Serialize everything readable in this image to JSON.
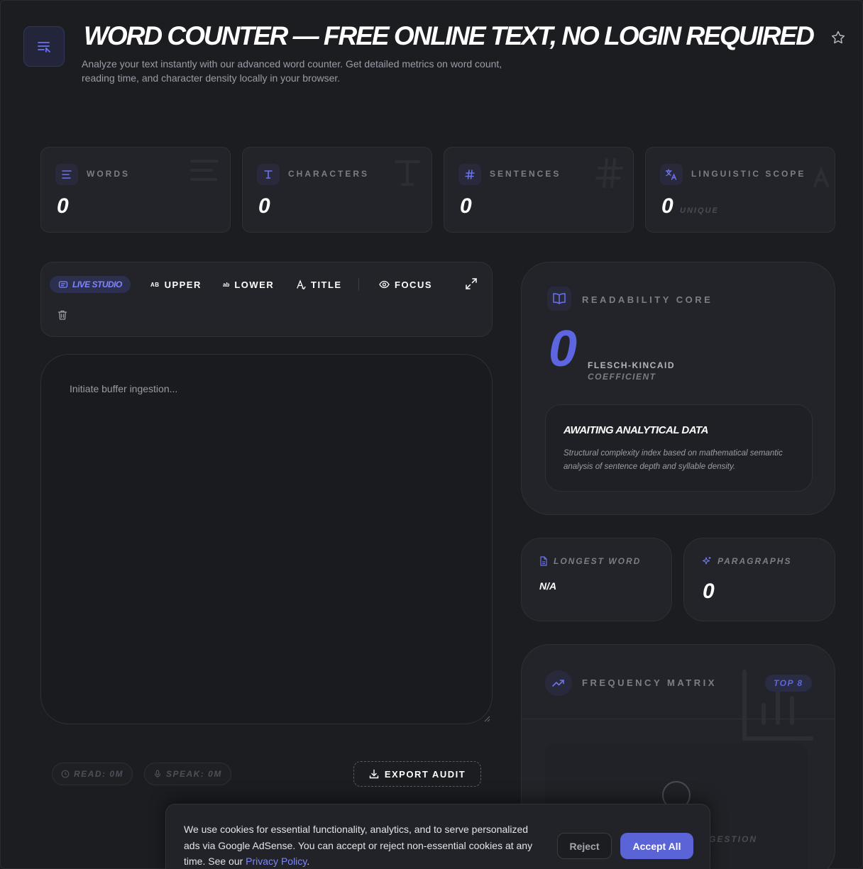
{
  "header": {
    "title": "WORD COUNTER — FREE ONLINE TEXT, NO LOGIN REQUIRED",
    "subtitle": "Analyze your text instantly with our advanced word counter. Get detailed metrics on word count, reading time, and character density locally in your browser.",
    "logo_icon": "text-lines-icon",
    "favorite_icon": "star-icon"
  },
  "stats": [
    {
      "label": "WORDS",
      "value": "0",
      "icon": "align-left-icon"
    },
    {
      "label": "CHARACTERS",
      "value": "0",
      "icon": "type-icon"
    },
    {
      "label": "SENTENCES",
      "value": "0",
      "icon": "hash-icon"
    },
    {
      "label": "LINGUISTIC SCOPE",
      "value": "0",
      "suffix": "UNIQUE",
      "icon": "translate-icon"
    }
  ],
  "toolbar": {
    "live_studio": "LIVE STUDIO",
    "upper": "UPPER",
    "upper_glyph": "AB",
    "lower": "LOWER",
    "lower_glyph": "ab",
    "title": "TITLE",
    "focus": "FOCUS"
  },
  "editor": {
    "placeholder": "Initiate buffer ingestion...",
    "value": ""
  },
  "footer": {
    "read": "READ: 0M",
    "speak": "SPEAK: 0M",
    "export": "EXPORT AUDIT"
  },
  "readability": {
    "label": "READABILITY CORE",
    "score": "0",
    "metric_line1": "FLESCH-KINCAID",
    "metric_line2": "COEFFICIENT",
    "status_title": "AWAITING ANALYTICAL DATA",
    "status_desc": "Structural complexity index based on mathematical semantic analysis of sentence depth and syllable density."
  },
  "longest_word": {
    "label": "LONGEST WORD",
    "value": "N/A"
  },
  "paragraphs": {
    "label": "PARAGRAPHS",
    "value": "0"
  },
  "frequency": {
    "label": "FREQUENCY MATRIX",
    "badge": "TOP 8",
    "status": "GESTION"
  },
  "cookie": {
    "text": "We use cookies for essential functionality, analytics, and to serve personalized ads via Google AdSense. You can accept or reject non-essential cookies at any time. See our ",
    "link": "Privacy Policy",
    "after": ".",
    "reject": "Reject",
    "accept": "Accept All"
  },
  "colors": {
    "background": "#1c1d21",
    "card": "#232429",
    "accent": "#5d65e0",
    "accent_light": "#7d86ff"
  }
}
